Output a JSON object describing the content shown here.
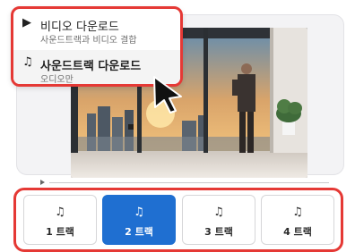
{
  "menu": {
    "items": [
      {
        "icon": "play-square-icon",
        "glyph": "▶",
        "title": "비디오 다운로드",
        "subtitle": "사운드트랙과 비디오 결합"
      },
      {
        "icon": "music-note-icon",
        "glyph": "♫",
        "title": "사운드트랙 다운로드",
        "subtitle": "오디오만"
      }
    ]
  },
  "tracks": {
    "items": [
      {
        "glyph": "♫",
        "label": "1 트랙",
        "selected": false
      },
      {
        "glyph": "♫",
        "label": "2 트랙",
        "selected": true
      },
      {
        "glyph": "♫",
        "label": "3 트랙",
        "selected": false
      },
      {
        "glyph": "♫",
        "label": "4 트랙",
        "selected": false
      }
    ]
  },
  "colors": {
    "highlight": "#e53935",
    "accent": "#1f6fd1"
  }
}
